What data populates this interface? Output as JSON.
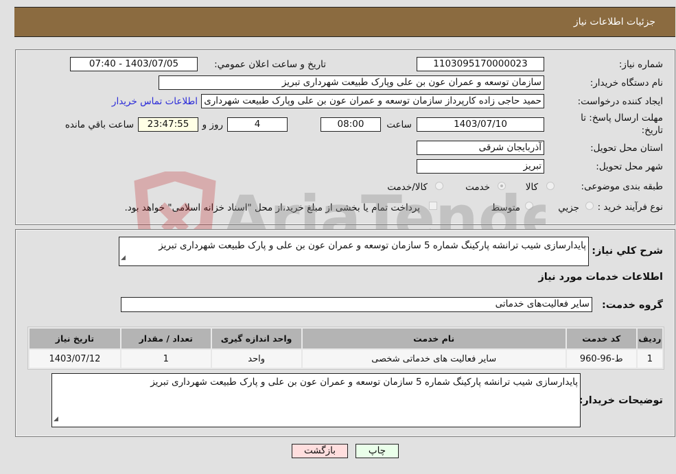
{
  "header": {
    "title": "جزئیات اطلاعات نیاز"
  },
  "details": {
    "need_number": {
      "label": "شماره نیاز:",
      "value": "1103095170000023"
    },
    "announce_datetime": {
      "label": "تاریخ و ساعت اعلان عمومي:",
      "value": "1403/07/05 - 07:40"
    },
    "buyer_org": {
      "label": "نام دستگاه خریدار:",
      "value": "سازمان توسعه و عمران عون بن علی وپارک طبیعت شهرداری تبریز"
    },
    "requester": {
      "label": "ایجاد کننده درخواست:",
      "value": "حمید حاجی زاده کارپرداز سازمان توسعه و عمران عون بن علی وپارک طبیعت شهرداری تبریز",
      "contact_link": "اطلاعات تماس خریدار"
    },
    "deadline": {
      "label_line1": "مهلت ارسال پاسخ: تا",
      "label_line2": "تاریخ:",
      "date": "1403/07/10",
      "time_label": "ساعت",
      "time": "08:00",
      "days": "4",
      "days_label": "روز و",
      "remaining": "23:47:55",
      "remaining_label": "ساعت باقي مانده"
    },
    "province": {
      "label": "استان محل تحویل:",
      "value": "آذربایجان شرقی"
    },
    "city": {
      "label": "شهر محل تحویل:",
      "value": "تبریز"
    },
    "category": {
      "label": "طبقه بندی موضوعی:",
      "options": [
        "کالا",
        "خدمت",
        "کالا/خدمت"
      ],
      "selected": "خدمت"
    },
    "process": {
      "label": "نوع فرآیند خرید :",
      "options": [
        "جزيي",
        "متوسط"
      ],
      "checkbox_label": "پرداخت تمام یا بخشی از مبلغ خرید،از محل \"اسناد خزانه اسلامی\" خواهد بود."
    }
  },
  "summary": {
    "label": "شرح کلي نیاز:",
    "value": "پایدارسازی شیب ترانشه پارکینگ شماره 5 سازمان توسعه و عمران عون بن علی و پارک طبیعت شهرداری تبریز"
  },
  "services": {
    "title": "اطلاعات خدمات مورد نیاز",
    "group_label": "گروه خدمت:",
    "group_value": "سایر فعالیت‌های خدماتی",
    "columns": [
      "ردیف",
      "کد خدمت",
      "نام خدمت",
      "واحد اندازه گیری",
      "تعداد / مقدار",
      "تاریخ نیاز"
    ],
    "rows": [
      [
        "1",
        "ط-96-960",
        "سایر فعالیت های خدماتی شخصی",
        "واحد",
        "1",
        "1403/07/12"
      ]
    ]
  },
  "buyer_notes": {
    "label": "توضیحات خریدار:",
    "value": "پایدارسازی شیب ترانشه پارکینگ شماره 5 سازمان توسعه و عمران عون بن علی و پارک طبیعت شهرداری تبریز"
  },
  "buttons": {
    "print": "چاپ",
    "back": "بازگشت"
  },
  "watermark": {
    "text": "AriaTender.net"
  }
}
